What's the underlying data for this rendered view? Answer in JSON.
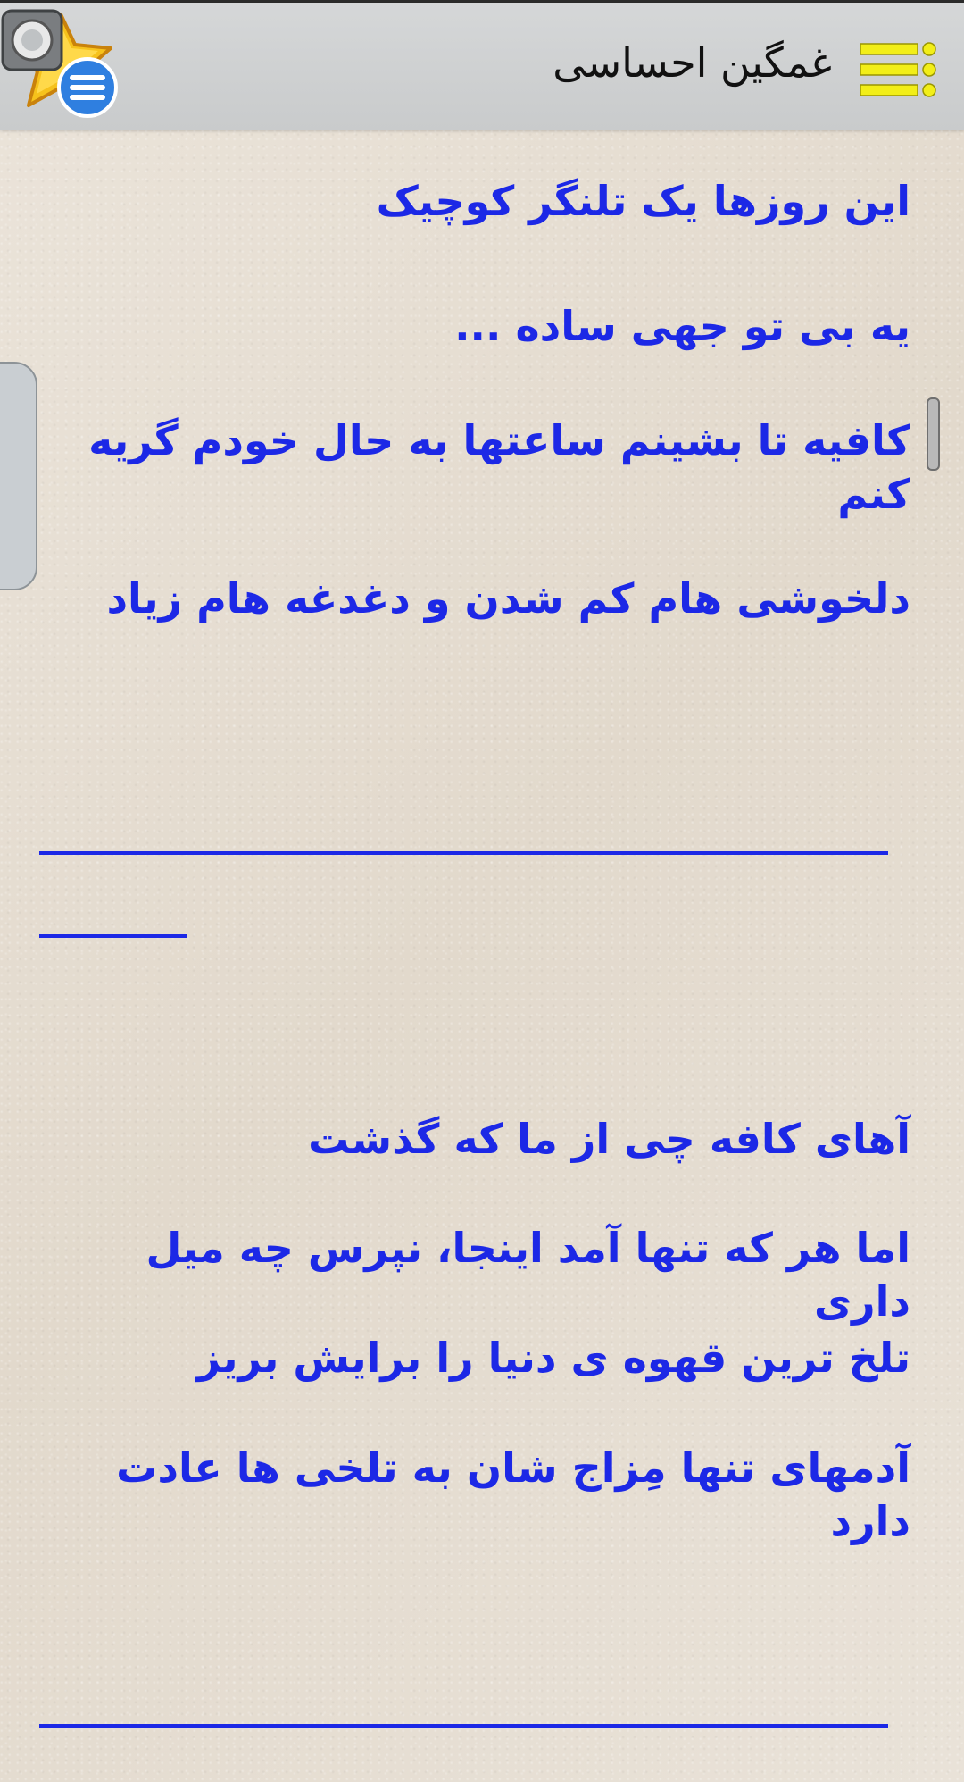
{
  "app_bar": {
    "title": "غمگین احساسی",
    "menu_icon": "hamburger-menu-icon",
    "logo_icon": "star-menu-logo-icon"
  },
  "content": {
    "lines": [
      "این روزها یک تلنگر کوچیک",
      "یه بی تو جهی ساده ...",
      "کافیه تا بشینم ساعتها به حال خودم گریه کنم",
      "دلخوشی هام کم شدن و دغدغه هام زیاد",
      "آهای کافه چی از ما که گذشت",
      "اما هر که تنها آمد اینجا، نپرس چه میل داری",
      "تلخ ترین قهوه ی دنیا را برایش بریز",
      "آدمهای تنها مِزاج شان به تلخی ها عادت دارد"
    ]
  },
  "colors": {
    "text": "#1c28e6",
    "appbar": "#cfd1d2",
    "background": "#e6ded2",
    "menu_icon": "#f2ee18"
  }
}
